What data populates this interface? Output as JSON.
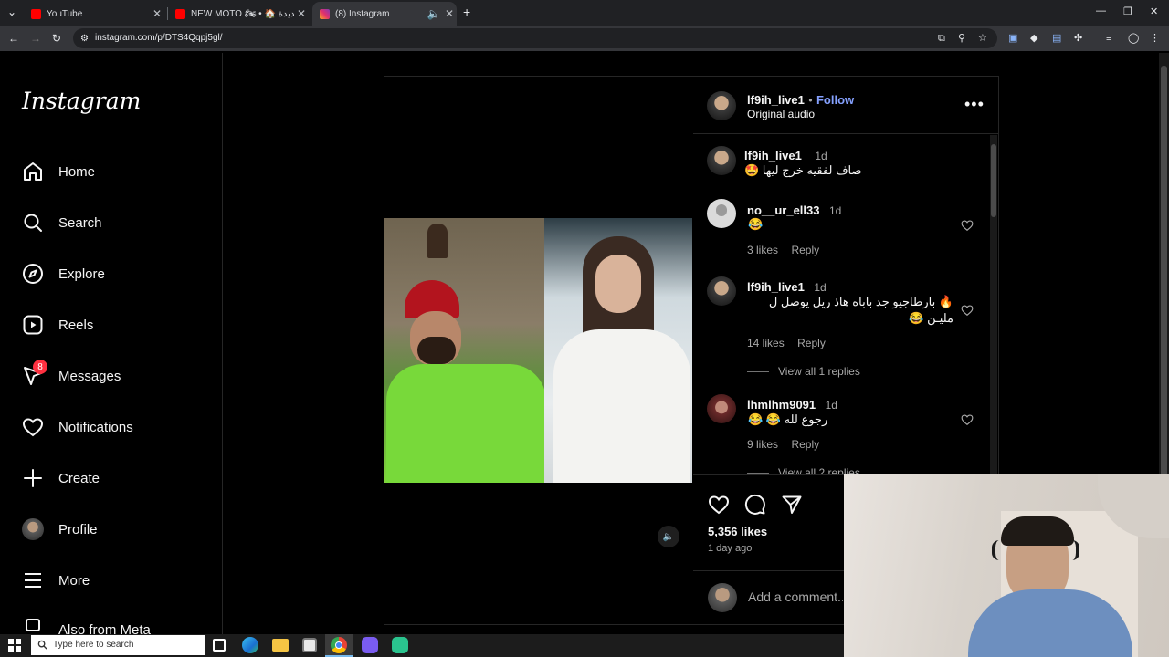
{
  "browser": {
    "tabs": [
      {
        "title": "YouTube",
        "icon": "youtube-icon",
        "color": "#ff0000"
      },
      {
        "title": "NEW MOTO 🏍 • 🏠 دار جديدة",
        "icon": "youtube-icon",
        "color": "#ff0000"
      },
      {
        "title": "(8) Instagram",
        "icon": "instagram-icon",
        "color": "#e1306c",
        "active": true
      }
    ],
    "url": "instagram.com/p/DTS4Qqpj5gl/"
  },
  "sidebar": {
    "logo": "Instagram",
    "items": [
      {
        "label": "Home",
        "icon": "home-icon"
      },
      {
        "label": "Search",
        "icon": "search-icon"
      },
      {
        "label": "Explore",
        "icon": "explore-compass-icon"
      },
      {
        "label": "Reels",
        "icon": "reels-icon"
      },
      {
        "label": "Messages",
        "icon": "messages-icon",
        "badge": "8"
      },
      {
        "label": "Notifications",
        "icon": "heart-icon"
      },
      {
        "label": "Create",
        "icon": "plus-icon"
      },
      {
        "label": "Profile",
        "icon": "profile-avatar"
      },
      {
        "label": "More",
        "icon": "hamburger-icon"
      },
      {
        "label": "Also from Meta",
        "icon": "meta-icon"
      }
    ]
  },
  "post": {
    "author": "lf9ih_live1",
    "dot": "•",
    "follow": "Follow",
    "audio": "Original audio",
    "comments": [
      {
        "user": "lf9ih_live1",
        "time": "1d",
        "text": "صاف لفقيه خرج ليها 🤩"
      },
      {
        "user": "no__ur_ell33",
        "time": "1d",
        "text": "😂",
        "likes": "3 likes",
        "reply": "Reply"
      },
      {
        "user": "lf9ih_live1",
        "time": "1d",
        "text_line1": "🔥 بارطاجيو جد باباه هاذ ريل يوصل ل",
        "text_line2": "مليـن 😂",
        "likes": "14 likes",
        "reply": "Reply",
        "view_replies": "View all 1 replies"
      },
      {
        "user": "lhmlhm9091",
        "time": "1d",
        "text": "رجوع لله 😂 😂",
        "likes": "9 likes",
        "reply": "Reply",
        "view_replies": "View all 2 replies"
      }
    ],
    "likes_count": "5,356 likes",
    "posted": "1 day ago",
    "add_comment_placeholder": "Add a comment..."
  },
  "taskbar": {
    "search_placeholder": "Type here to search"
  }
}
